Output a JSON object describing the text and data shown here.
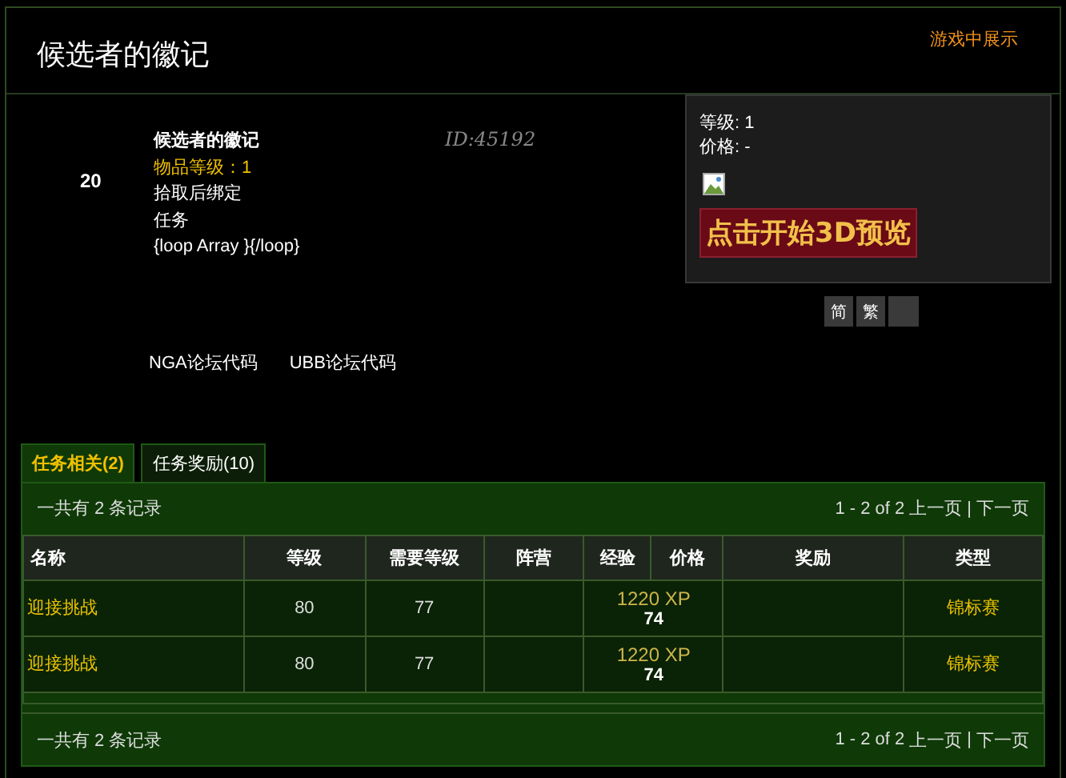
{
  "header": {
    "title": "候选者的徽记",
    "ingame_link": "游戏中展示"
  },
  "item": {
    "icon_count": "20",
    "name": "候选者的徽记",
    "item_level": "物品等级：1",
    "bind": "拾取后绑定",
    "type": "任务",
    "template": "{loop Array }{/loop}",
    "id": "ID:45192"
  },
  "side_panel": {
    "level": "等级: 1",
    "price": "价格: -",
    "preview_button": "点击开始3D预览",
    "lang_buttons": [
      "简",
      "繁"
    ]
  },
  "code_links": [
    "NGA论坛代码",
    "UBB论坛代码"
  ],
  "tabs": [
    {
      "label": "任务相关(2)",
      "selected": true
    },
    {
      "label": "任务奖励(10)",
      "selected": false
    }
  ],
  "summary_top": {
    "count": "一共有 2 条记录",
    "pager": {
      "range": "1 - 2 of 2",
      "prev": "上一页",
      "separator": "|",
      "next": "下一页"
    }
  },
  "table": {
    "columns": [
      "名称",
      "等级",
      "需要等级",
      "阵营",
      "经验",
      "价格",
      "奖励",
      "类型"
    ],
    "rows": [
      {
        "name": "迎接挑战",
        "level": "80",
        "req_level": "77",
        "xp": "1220 XP",
        "price": "74",
        "type": "锦标赛"
      },
      {
        "name": "迎接挑战",
        "level": "80",
        "req_level": "77",
        "xp": "1220 XP",
        "price": "74",
        "type": "锦标赛"
      }
    ]
  },
  "summary_bottom": {
    "count": "一共有 2 条记录",
    "pager": {
      "range": "1 - 2 of 2",
      "prev": "上一页",
      "separator": "|",
      "next": "下一页"
    }
  }
}
